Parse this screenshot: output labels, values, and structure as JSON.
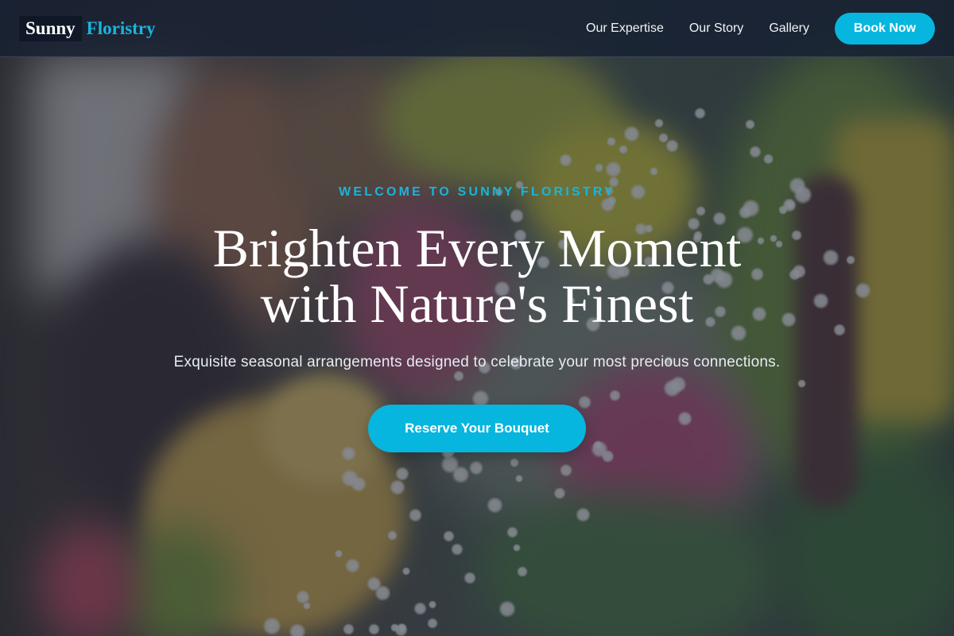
{
  "brand": {
    "part_1": "Sunny",
    "part_2": "Floristry"
  },
  "nav": {
    "items": [
      {
        "label": "Our Expertise"
      },
      {
        "label": "Our Story"
      },
      {
        "label": "Gallery"
      }
    ],
    "cta_label": "Book Now"
  },
  "hero": {
    "eyebrow": "WELCOME TO SUNNY FLORISTRY",
    "headline_line_1": "Brighten Every Moment",
    "headline_line_2": "with Nature's Finest",
    "subtext": "Exquisite seasonal arrangements designed to celebrate your most precious connections.",
    "cta_label": "Reserve Your Bouquet",
    "background": "blurred bouquet of yellow roses, pink alstroemeria, green chrysanthemums and white baby's breath"
  },
  "colors": {
    "accent": "#06b6de",
    "overlay": "#1c2434",
    "header_bg": "#162032",
    "text_light": "#ffffff"
  }
}
